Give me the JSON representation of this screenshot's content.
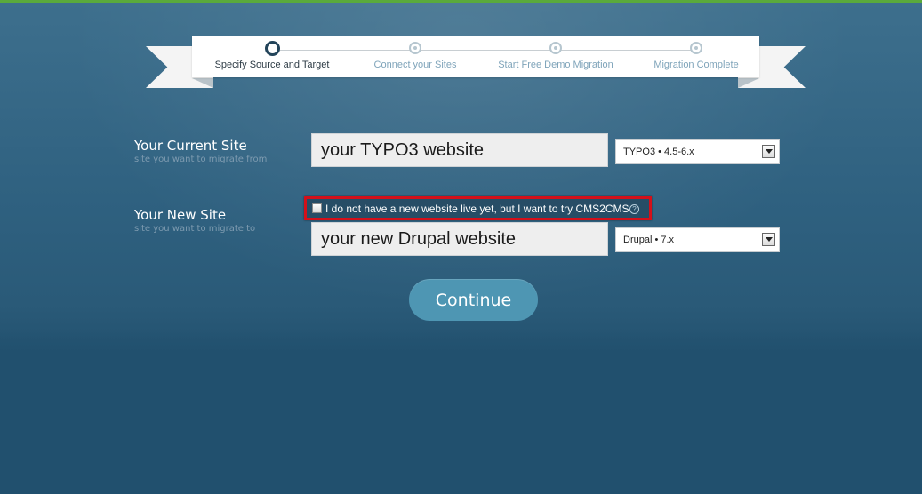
{
  "steps": [
    {
      "label": "Specify Source and Target",
      "active": true
    },
    {
      "label": "Connect your Sites",
      "active": false
    },
    {
      "label": "Start Free Demo Migration",
      "active": false
    },
    {
      "label": "Migration Complete",
      "active": false
    }
  ],
  "current_site": {
    "label": "Your Current Site",
    "sublabel": "site you want to migrate from",
    "input_value": "your TYPO3 website",
    "select_value": "TYPO3 • 4.5-6.x"
  },
  "new_site": {
    "label": "Your New Site",
    "sublabel": "site you want to migrate to",
    "input_value": "your new Drupal website",
    "select_value": "Drupal • 7.x"
  },
  "no_site_checkbox": {
    "label": "I do not have a new website live yet, but I want to try CMS2CMS",
    "checked": false,
    "help_glyph": "?"
  },
  "continue_label": "Continue",
  "colors": {
    "accent_green": "#5aaa3c",
    "button": "#4e96b3",
    "highlight_border": "#d4101a",
    "background": "#21506e"
  }
}
